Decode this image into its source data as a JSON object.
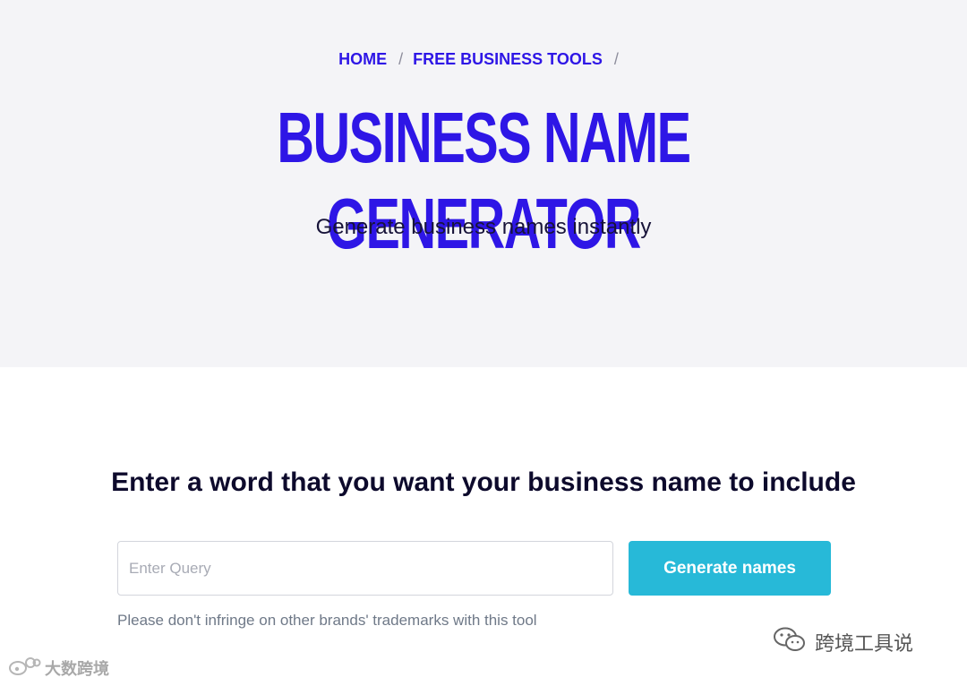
{
  "breadcrumb": {
    "items": [
      "HOME",
      "FREE BUSINESS TOOLS"
    ],
    "separator": "/"
  },
  "hero": {
    "title": "BUSINESS NAME GENERATOR",
    "subtitle": "Generate business names instantly"
  },
  "form": {
    "heading": "Enter a word that you want your business name to include",
    "input_value": "",
    "input_placeholder": "Enter Query",
    "button_label": "Generate names",
    "disclaimer": "Please don't infringe on other brands' trademarks with this tool"
  },
  "watermarks": {
    "right_text": "跨境工具说",
    "right_icon": "wechat-icon",
    "left_text": "大数跨境",
    "left_icon": "weibo-icon"
  },
  "colors": {
    "accent": "#2e16e6",
    "hero_bg": "#f4f4f7",
    "button_bg": "#27b9d8",
    "heading_text": "#0d0a2c",
    "muted_text": "#6f7988"
  }
}
